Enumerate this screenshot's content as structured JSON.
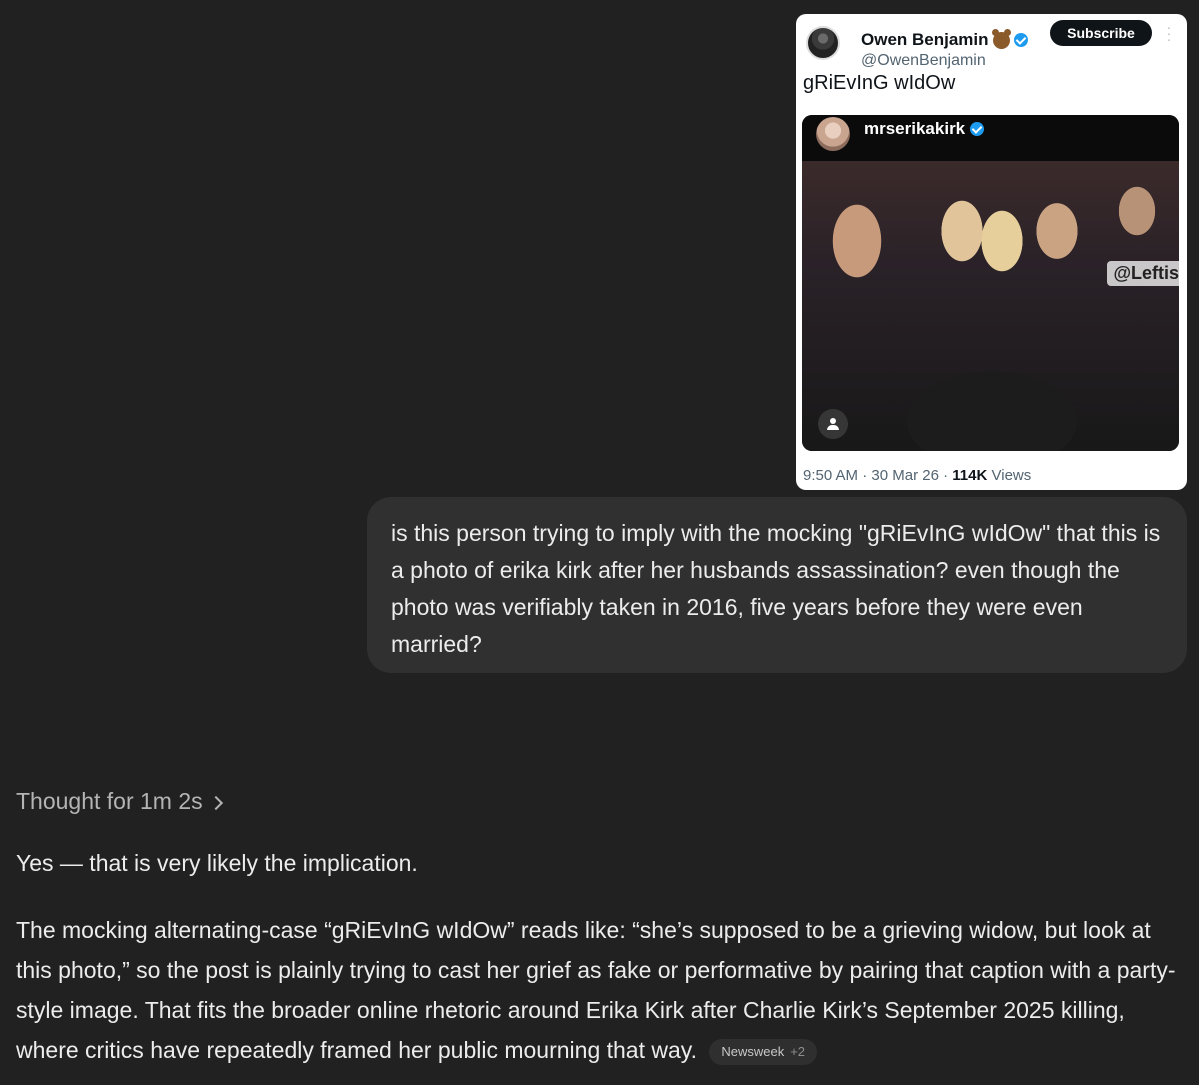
{
  "tweet": {
    "author_name": "Owen Benjamin",
    "handle": "@OwenBenjamin",
    "subscribe_label": "Subscribe",
    "text": "gRiEvInG wIdOw",
    "embedded": {
      "username": "mrserikakirk",
      "watermark": "@Leftis"
    },
    "time": "9:50 AM",
    "date": "30 Mar 26",
    "views_count": "114K",
    "views_label": "Views"
  },
  "user_message": "is this person trying to imply with the mocking \"gRiEvInG wIdOw\" that this is a photo of erika kirk after her husbands assassination? even though the photo was verifiably taken in 2016, five years before they were even married?",
  "assistant": {
    "thought_label": "Thought for 1m 2s",
    "first_line": "Yes — that is very likely the implication.",
    "paragraph": "The mocking alternating-case “gRiEvInG wIdOw” reads like: “she’s supposed to be a grieving widow, but look at this photo,” so the post is plainly trying to cast her grief as fake or performative by pairing that caption with a party-style image. That fits the broader online rhetoric around Erika Kirk after Charlie Kirk’s September 2025 killing, where critics have repeatedly framed her public mourning that way.",
    "source_label": "Newsweek",
    "source_extra": "+2"
  }
}
